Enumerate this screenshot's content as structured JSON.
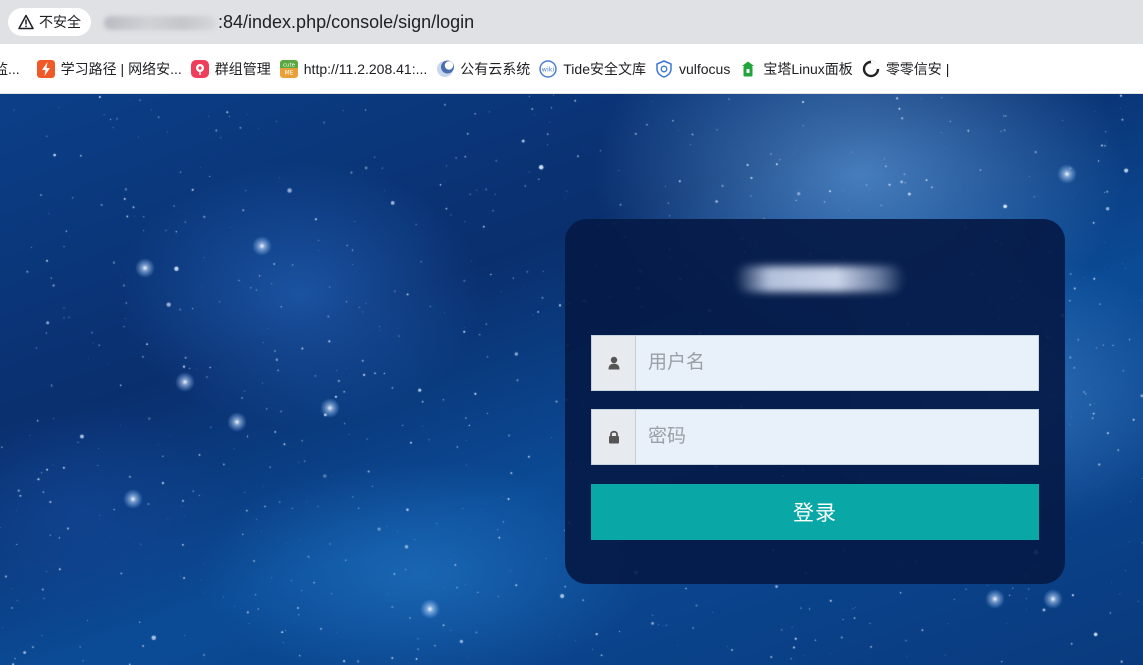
{
  "browser": {
    "security_label": "不安全",
    "url_visible": ":84/index.php/console/sign/login",
    "bookmarks": [
      {
        "label": "监...",
        "icon": "none",
        "color": "#ffffff"
      },
      {
        "label": "学习路径 | 网络安...",
        "icon": "lightning-icon",
        "color": "#f05a28"
      },
      {
        "label": "群组管理",
        "icon": "flower-icon",
        "color": "#ef3e5b"
      },
      {
        "label": "http://11.2.208.41:...",
        "icon": "cute-me-icon",
        "color": "#e8a13a"
      },
      {
        "label": "公有云系统",
        "icon": "moon-icon",
        "color": "#6b8fc7"
      },
      {
        "label": "Tide安全文库",
        "icon": "wiki-icon",
        "color": "#4a7fd0"
      },
      {
        "label": "vulfocus",
        "icon": "shield-icon",
        "color": "#3a78d4"
      },
      {
        "label": "宝塔Linux面板",
        "icon": "pagoda-icon",
        "color": "#20a53a"
      },
      {
        "label": "零零信安 |",
        "icon": "ring-icon",
        "color": "#222222"
      }
    ]
  },
  "login": {
    "username_placeholder": "用户名",
    "password_placeholder": "密码",
    "submit_label": "登录"
  },
  "colors": {
    "button": "#0aa7a7",
    "card": "#051a46",
    "field_bg": "#e8f0fa"
  }
}
